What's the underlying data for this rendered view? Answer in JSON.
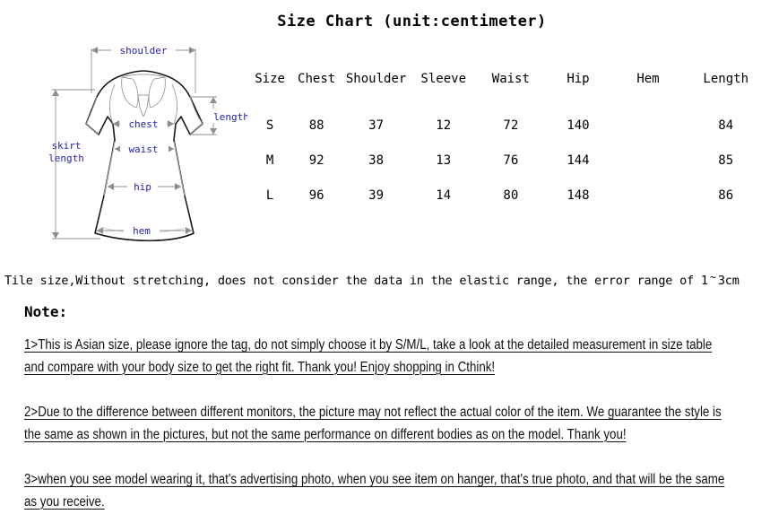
{
  "chart_data": {
    "type": "table",
    "title": "Size Chart (unit:centimeter)",
    "columns": [
      "Size",
      "Chest",
      "Shoulder",
      "Sleeve",
      "Waist",
      "Hip",
      "Hem",
      "Length"
    ],
    "rows": [
      {
        "size": "S",
        "chest": "88",
        "shoulder": "37",
        "sleeve": "12",
        "waist": "72",
        "hip": "140",
        "hem": "",
        "length": "84"
      },
      {
        "size": "M",
        "chest": "92",
        "shoulder": "38",
        "sleeve": "13",
        "waist": "76",
        "hip": "144",
        "hem": "",
        "length": "85"
      },
      {
        "size": "L",
        "chest": "96",
        "shoulder": "39",
        "sleeve": "14",
        "waist": "80",
        "hip": "148",
        "hem": "",
        "length": "86"
      }
    ]
  },
  "title": "Size Chart (unit:centimeter)",
  "diagram": {
    "label_color": "#2323a8",
    "labels": {
      "shoulder": "shoulder",
      "length": "length",
      "chest": "chest",
      "skirt_length_line1": "skirt",
      "skirt_length_line2": "length",
      "waist": "waist",
      "hip": "hip",
      "hem": "hem"
    }
  },
  "tile_note": {
    "part1": "Tile size,Without stretching, does not consider the data in the elastic range, the error range of 1",
    "tilde": "~",
    "part2": "3cm"
  },
  "note_heading": "Note:",
  "notes": {
    "item1": "1>This is Asian size, please ignore the tag, do not simply choose it by S/M/L, take a look at the detailed measurement in size table and compare with your body size to get the right fit. Thank you!   Enjoy shopping in Cthink!",
    "item2": "2>Due to the difference between different monitors, the picture may not reflect the actual color of the item. We guarantee the style is the same as shown in the pictures, but not the same performance on different bodies as on the model. Thank you!",
    "item3": "3>when you see model wearing it, that's advertising photo, when you see item on hanger, that's true photo, and that will be the same as you receive."
  }
}
